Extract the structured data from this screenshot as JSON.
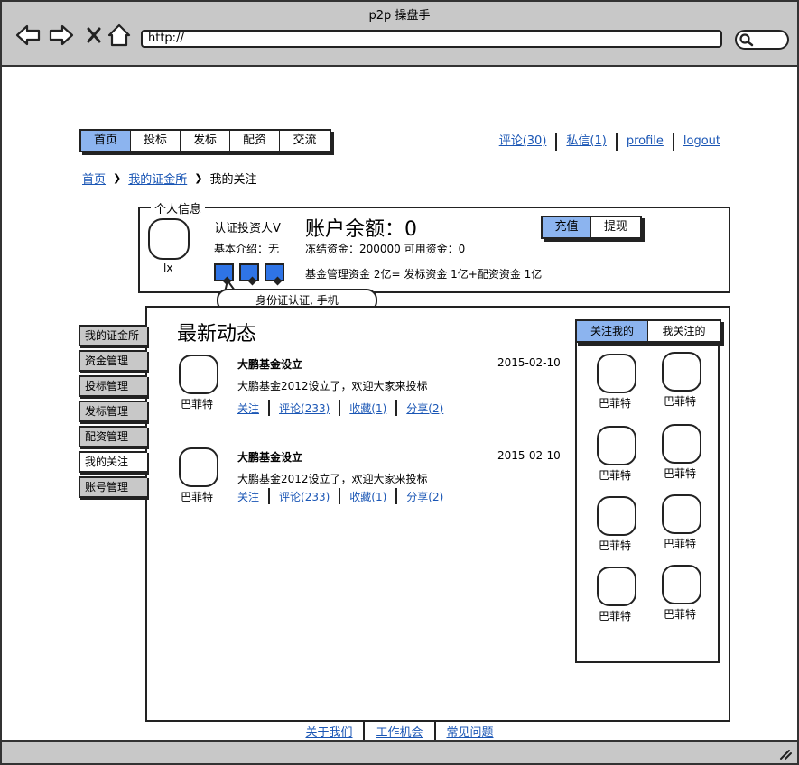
{
  "browser": {
    "title": "p2p 操盘手",
    "url": "http://"
  },
  "nav": {
    "tabs": [
      {
        "label": "首页",
        "active": true
      },
      {
        "label": "投标",
        "active": false
      },
      {
        "label": "发标",
        "active": false
      },
      {
        "label": "配资",
        "active": false
      },
      {
        "label": "交流",
        "active": false
      }
    ],
    "links": [
      "评论(30)",
      "私信(1)",
      "profile",
      "logout"
    ]
  },
  "breadcrumb": [
    "首页",
    "我的证金所",
    "我的关注"
  ],
  "personal": {
    "legend": "个人信息",
    "name": "lx",
    "cert": "认证投资人V",
    "intro": "基本介绍：无",
    "balance": "账户余额：0",
    "frozen": "冻结资金：200000 可用资金：0",
    "fund": "基金管理资金 2亿= 发标资金 1亿+配资资金 1亿",
    "buttons": [
      "充值",
      "提现"
    ],
    "tooltip": "身份证认证, 手机"
  },
  "sidebar": [
    "我的证金所",
    "资金管理",
    "投标管理",
    "发标管理",
    "配资管理",
    "我的关注",
    "账号管理"
  ],
  "feed": {
    "title": "最新动态",
    "items": [
      {
        "author": "巴菲特",
        "title": "大鹏基金设立",
        "date": "2015-02-10",
        "desc": "大鹏基金2012设立了，欢迎大家来投标",
        "actions": [
          "关注",
          "评论(233)",
          "收藏(1)",
          "分享(2)"
        ]
      },
      {
        "author": "巴菲特",
        "title": "大鹏基金设立",
        "date": "2015-02-10",
        "desc": "大鹏基金2012设立了，欢迎大家来投标",
        "actions": [
          "关注",
          "评论(233)",
          "收藏(1)",
          "分享(2)"
        ]
      }
    ]
  },
  "follow": {
    "tabs": [
      "关注我的",
      "我关注的"
    ],
    "users": [
      "巴菲特",
      "巴菲特",
      "巴菲特",
      "巴菲特",
      "巴菲特",
      "巴菲特",
      "巴菲特",
      "巴菲特"
    ]
  },
  "footer": [
    "关于我们",
    "工作机会",
    "常见问题"
  ],
  "colors": {
    "accent": "#8cb4ef",
    "badge": "#2f74e6",
    "link": "#1a56b5",
    "chrome": "#c8c8c8"
  }
}
